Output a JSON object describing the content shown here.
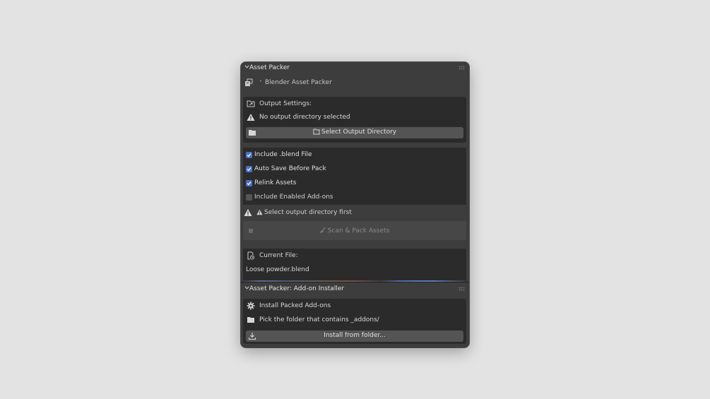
{
  "panel1": {
    "title": "Asset Packer",
    "addon_name": "Blender Asset Packer",
    "output_heading": "Output Settings:",
    "output_status": "No output directory selected",
    "select_dir_button": "Select Output Directory",
    "options": [
      {
        "label": "Include .blend File",
        "checked": true
      },
      {
        "label": "Auto Save Before Pack",
        "checked": true
      },
      {
        "label": "Relink Assets",
        "checked": true
      },
      {
        "label": "Include Enabled Add-ons",
        "checked": false
      }
    ],
    "warning": "Select output directory first",
    "scan_button": "Scan & Pack Assets",
    "current_file_heading": "Current File:",
    "current_file_name": "Loose powder.blend"
  },
  "panel2": {
    "title": "Asset Packer: Add-on Installer",
    "install_heading": "Install Packed Add-ons",
    "instructions": "Pick the folder that contains _addons/",
    "install_button": "Install from folder..."
  },
  "colors": {
    "window_bg": "#3d3d3d",
    "box_bg": "#2b2b2b",
    "button_bg": "#545454",
    "checkbox_on": "#4a72c4",
    "page_bg": "#e3e3e3"
  },
  "icons": [
    "addon-package-icon",
    "folder-output-icon",
    "warning-icon",
    "folder-icon",
    "brush-icon",
    "file-icon",
    "gear-icon",
    "download-icon",
    "chevron-down-icon"
  ]
}
